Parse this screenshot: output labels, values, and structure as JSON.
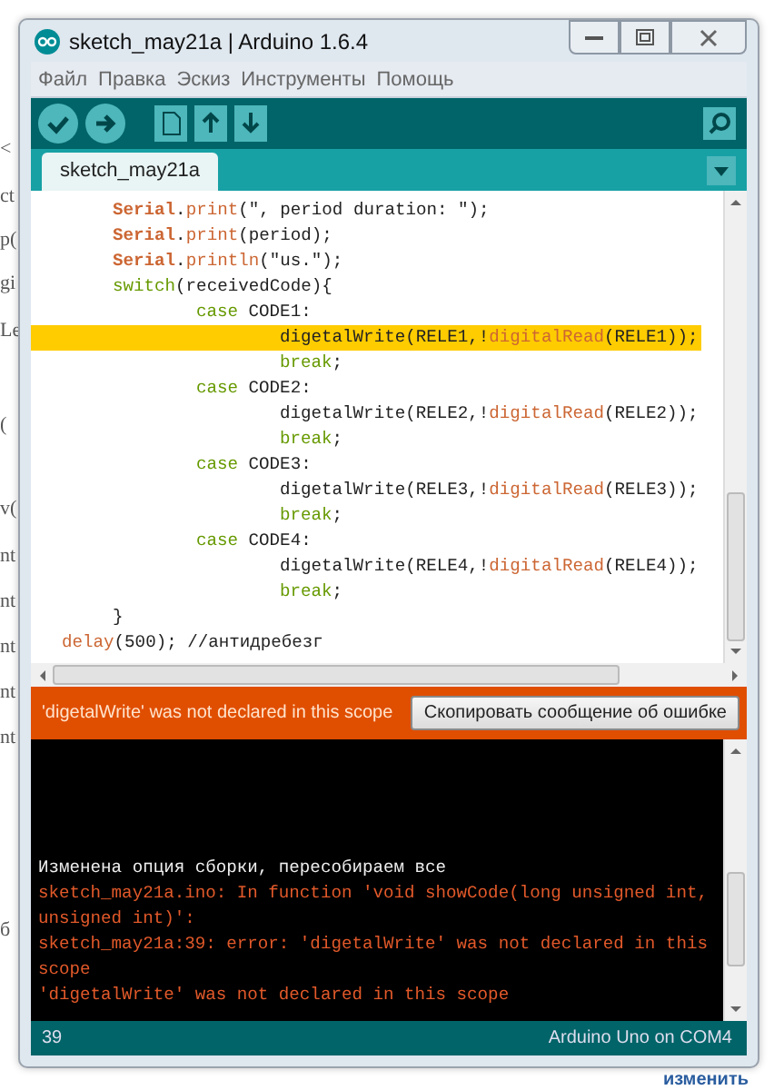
{
  "background_page": {
    "left_fragments": [
      "<",
      "ct",
      "p(",
      "gi",
      "Le",
      "(",
      "v(",
      "nt",
      "nt",
      "nt",
      "nt",
      "nt",
      "б"
    ],
    "link": "изменить"
  },
  "window": {
    "title": "sketch_may21a | Arduino 1.6.4"
  },
  "menu": [
    "Файл",
    "Правка",
    "Эскиз",
    "Инструменты",
    "Помощь"
  ],
  "tabs": [
    {
      "label": "sketch_may21a",
      "selected": true
    }
  ],
  "editor": {
    "lines": [
      {
        "kind": "block",
        "highlighted": false,
        "tokens": [
          {
            "text": "Serial",
            "kind": "class"
          },
          {
            "text": ".",
            "kind": "plain"
          },
          {
            "text": "print",
            "kind": "func"
          },
          {
            "text": "(\", period duration: \");",
            "kind": "plain"
          }
        ]
      },
      {
        "kind": "block",
        "highlighted": false,
        "tokens": [
          {
            "text": "Serial",
            "kind": "class"
          },
          {
            "text": ".",
            "kind": "plain"
          },
          {
            "text": "print",
            "kind": "func"
          },
          {
            "text": "(period);",
            "kind": "plain"
          }
        ]
      },
      {
        "kind": "block",
        "highlighted": false,
        "tokens": [
          {
            "text": "Serial",
            "kind": "class"
          },
          {
            "text": ".",
            "kind": "plain"
          },
          {
            "text": "println",
            "kind": "func"
          },
          {
            "text": "(\"us.\");",
            "kind": "plain"
          }
        ]
      },
      {
        "kind": "block",
        "highlighted": false,
        "tokens": [
          {
            "text": "switch",
            "kind": "keyword"
          },
          {
            "text": "(receivedCode){",
            "kind": "plain"
          }
        ]
      },
      {
        "kind": "case",
        "highlighted": false,
        "tokens": [
          {
            "text": "case",
            "kind": "keyword"
          },
          {
            "text": " CODE1:",
            "kind": "plain"
          }
        ]
      },
      {
        "kind": "body",
        "highlighted": true,
        "tokens": [
          {
            "text": "digetalWrite(RELE1,!",
            "kind": "plain"
          },
          {
            "text": "digitalRead",
            "kind": "func"
          },
          {
            "text": "(RELE1));",
            "kind": "plain"
          }
        ]
      },
      {
        "kind": "body",
        "highlighted": false,
        "tokens": [
          {
            "text": "break",
            "kind": "keyword"
          },
          {
            "text": ";",
            "kind": "plain"
          }
        ]
      },
      {
        "kind": "case",
        "highlighted": false,
        "tokens": [
          {
            "text": "case",
            "kind": "keyword"
          },
          {
            "text": " CODE2:",
            "kind": "plain"
          }
        ]
      },
      {
        "kind": "body",
        "highlighted": false,
        "tokens": [
          {
            "text": "digetalWrite(RELE2,!",
            "kind": "plain"
          },
          {
            "text": "digitalRead",
            "kind": "func"
          },
          {
            "text": "(RELE2));",
            "kind": "plain"
          }
        ]
      },
      {
        "kind": "body",
        "highlighted": false,
        "tokens": [
          {
            "text": "break",
            "kind": "keyword"
          },
          {
            "text": ";",
            "kind": "plain"
          }
        ]
      },
      {
        "kind": "case",
        "highlighted": false,
        "tokens": [
          {
            "text": "case",
            "kind": "keyword"
          },
          {
            "text": " CODE3:",
            "kind": "plain"
          }
        ]
      },
      {
        "kind": "body",
        "highlighted": false,
        "tokens": [
          {
            "text": "digetalWrite(RELE3,!",
            "kind": "plain"
          },
          {
            "text": "digitalRead",
            "kind": "func"
          },
          {
            "text": "(RELE3));",
            "kind": "plain"
          }
        ]
      },
      {
        "kind": "body",
        "highlighted": false,
        "tokens": [
          {
            "text": "break",
            "kind": "keyword"
          },
          {
            "text": ";",
            "kind": "plain"
          }
        ]
      },
      {
        "kind": "case",
        "highlighted": false,
        "tokens": [
          {
            "text": "case",
            "kind": "keyword"
          },
          {
            "text": " CODE4:",
            "kind": "plain"
          }
        ]
      },
      {
        "kind": "body",
        "highlighted": false,
        "tokens": [
          {
            "text": "digetalWrite(RELE4,!",
            "kind": "plain"
          },
          {
            "text": "digitalRead",
            "kind": "func"
          },
          {
            "text": "(RELE4));",
            "kind": "plain"
          }
        ]
      },
      {
        "kind": "body",
        "highlighted": false,
        "tokens": [
          {
            "text": "break",
            "kind": "keyword"
          },
          {
            "text": ";",
            "kind": "plain"
          }
        ]
      },
      {
        "kind": "block",
        "highlighted": false,
        "tokens": [
          {
            "text": "}",
            "kind": "plain"
          }
        ]
      },
      {
        "kind": "top",
        "highlighted": false,
        "tokens": [
          {
            "text": "delay",
            "kind": "func"
          },
          {
            "text": "(500); //антидребезг",
            "kind": "plain"
          }
        ]
      }
    ]
  },
  "error_bar": {
    "message": "'digetalWrite' was not declared in this scope",
    "button": "Скопировать сообщение об ошибке"
  },
  "console": {
    "lines": [
      {
        "kind": "info",
        "text": "Изменена опция сборки, пересобираем все"
      },
      {
        "kind": "error",
        "text": "sketch_may21a.ino: In function 'void showCode(long unsigned int,"
      },
      {
        "kind": "error",
        "text": "unsigned int)':"
      },
      {
        "kind": "error",
        "text": "sketch_may21a:39: error: 'digetalWrite' was not declared in this"
      },
      {
        "kind": "error",
        "text": "scope"
      },
      {
        "kind": "error",
        "text": "'digetalWrite' was not declared in this scope"
      }
    ]
  },
  "status_bar": {
    "line": "39",
    "board": "Arduino Uno on COM4"
  }
}
